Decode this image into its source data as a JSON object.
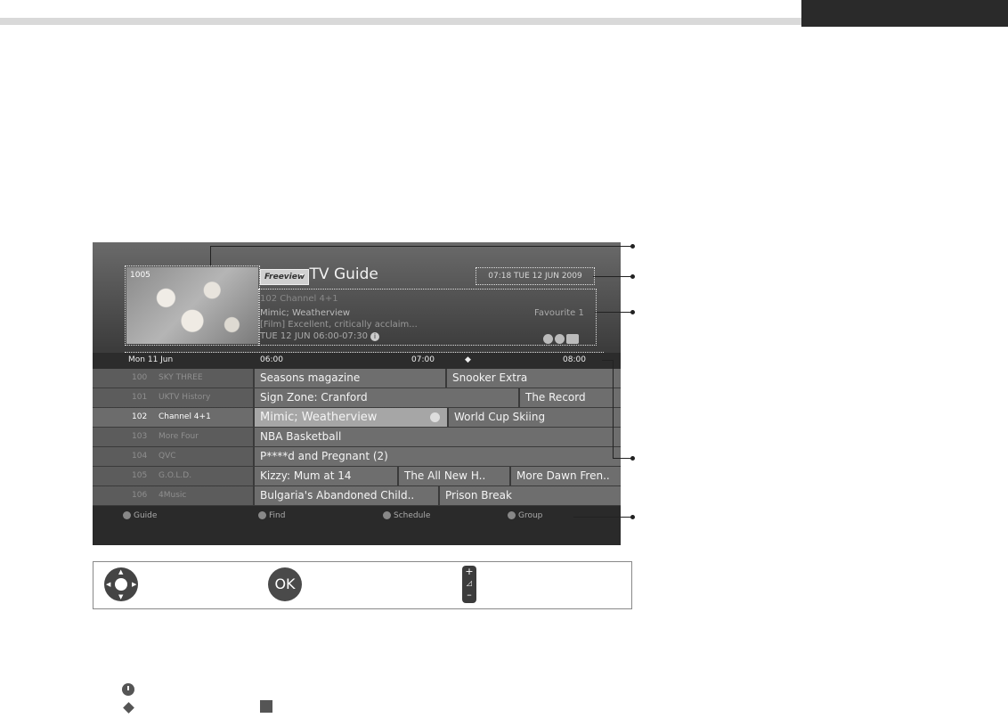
{
  "tv": {
    "channel_number_thumb": "1005",
    "brand": "Freeview",
    "title": "- TV Guide",
    "datetime": "07:18 TUE 12 JUN 2009",
    "info": {
      "channel": "102 Channel 4+1",
      "programme": "Mimic; Weatherview",
      "favourite": "Favourite 1",
      "description": "[Film] Excellent, critically acclaim...",
      "time": "TUE 12 JUN  06:00-07:30",
      "info_glyph": "i"
    },
    "timeline": {
      "date": "Mon 11 Jun",
      "t1": "06:00",
      "t2": "07:00",
      "t3": "08:00"
    },
    "rows": [
      {
        "num": "100",
        "name": "SKY THREE",
        "p1": "Seasons magazine",
        "p2": "Snooker Extra",
        "p3": ""
      },
      {
        "num": "101",
        "name": "UKTV History",
        "p1": "Sign Zone: Cranford",
        "p2": "The Record",
        "p3": ""
      },
      {
        "num": "102",
        "name": "Channel 4+1",
        "p1": "Mimic; Weatherview",
        "p2": "World Cup Skiing",
        "p3": ""
      },
      {
        "num": "103",
        "name": "More Four",
        "p1": "NBA Basketball",
        "p2": "",
        "p3": ""
      },
      {
        "num": "104",
        "name": "QVC",
        "p1": "P****d and Pregnant (2)",
        "p2": "",
        "p3": ""
      },
      {
        "num": "105",
        "name": "G.O.L.D.",
        "p1": "Kizzy: Mum at 14",
        "p2": "The All New H..",
        "p3": "More Dawn Fren.."
      },
      {
        "num": "106",
        "name": "4Music",
        "p1": "Bulgaria's Abandoned Child..",
        "p2": "Prison Break",
        "p3": ""
      }
    ],
    "buttons": {
      "guide": "Guide",
      "find": "Find",
      "schedule": "Schedule",
      "group": "Group"
    }
  },
  "remote": {
    "ok_label": "OK",
    "vol_plus": "+",
    "vol_minus": "–"
  },
  "colors": {
    "screen_bg": "#3c3c3c",
    "highlight": "#a6a6a6",
    "programme_cell": "#6e6e6e"
  }
}
